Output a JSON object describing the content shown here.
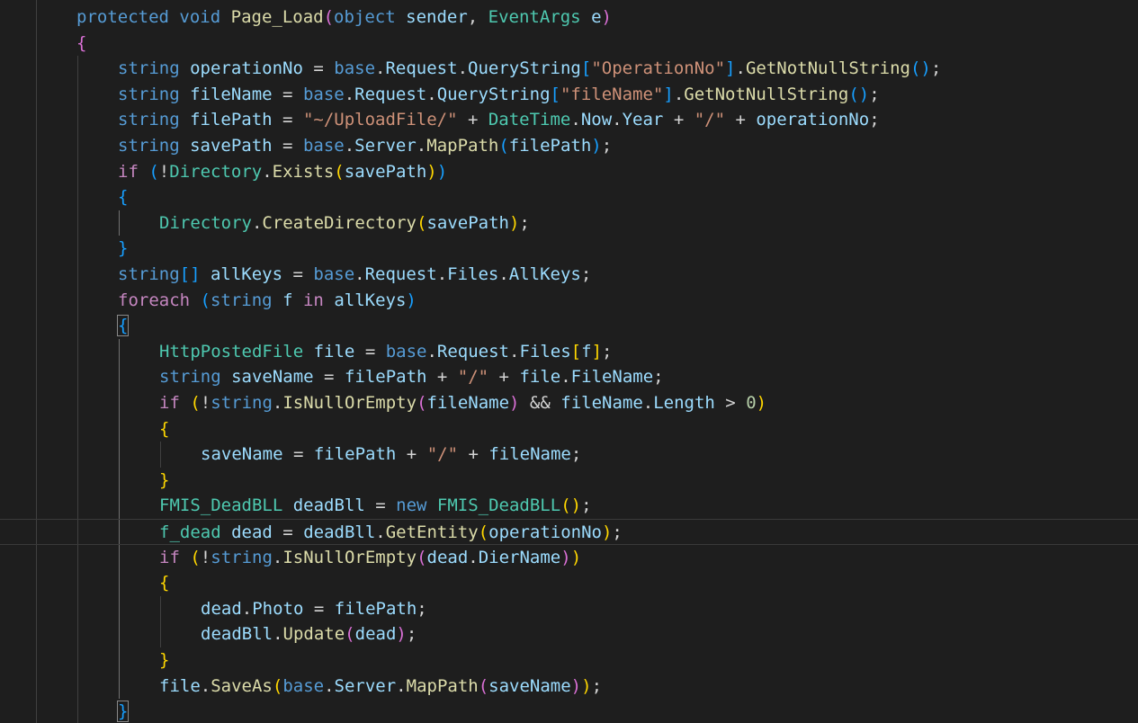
{
  "editor": {
    "language": "csharp",
    "theme": "dark",
    "colors": {
      "background": "#1e1e1e",
      "keyword": "#569cd6",
      "control": "#c586c0",
      "type": "#4ec9b0",
      "function": "#dcdcaa",
      "variable": "#9cdcfe",
      "string": "#ce9178",
      "number": "#b5cea8",
      "bracket_level_1": "#ffd700",
      "bracket_level_2": "#da70d6",
      "bracket_level_3": "#179fff"
    },
    "current_line": 20,
    "matched_bracket_lines": [
      12,
      27
    ],
    "lines": [
      {
        "indent": 1,
        "tokens": [
          {
            "t": "kw",
            "v": "protected"
          },
          {
            "t": "p",
            "v": " "
          },
          {
            "t": "kw",
            "v": "void"
          },
          {
            "t": "p",
            "v": " "
          },
          {
            "t": "fn",
            "v": "Page_Load"
          },
          {
            "t": "b2",
            "v": "("
          },
          {
            "t": "kw",
            "v": "object"
          },
          {
            "t": "p",
            "v": " "
          },
          {
            "t": "var",
            "v": "sender"
          },
          {
            "t": "p",
            "v": ", "
          },
          {
            "t": "type",
            "v": "EventArgs"
          },
          {
            "t": "p",
            "v": " "
          },
          {
            "t": "var",
            "v": "e"
          },
          {
            "t": "b2",
            "v": ")"
          }
        ]
      },
      {
        "indent": 1,
        "tokens": [
          {
            "t": "b2",
            "v": "{"
          }
        ]
      },
      {
        "indent": 2,
        "tokens": [
          {
            "t": "kw",
            "v": "string"
          },
          {
            "t": "p",
            "v": " "
          },
          {
            "t": "var",
            "v": "operationNo"
          },
          {
            "t": "p",
            "v": " = "
          },
          {
            "t": "kw",
            "v": "base"
          },
          {
            "t": "p",
            "v": "."
          },
          {
            "t": "var",
            "v": "Request"
          },
          {
            "t": "p",
            "v": "."
          },
          {
            "t": "var",
            "v": "QueryString"
          },
          {
            "t": "b3",
            "v": "["
          },
          {
            "t": "str",
            "v": "\"OperationNo\""
          },
          {
            "t": "b3",
            "v": "]"
          },
          {
            "t": "p",
            "v": "."
          },
          {
            "t": "fn",
            "v": "GetNotNullString"
          },
          {
            "t": "b3",
            "v": "()"
          },
          {
            "t": "p",
            "v": ";"
          }
        ]
      },
      {
        "indent": 2,
        "tokens": [
          {
            "t": "kw",
            "v": "string"
          },
          {
            "t": "p",
            "v": " "
          },
          {
            "t": "var",
            "v": "fileName"
          },
          {
            "t": "p",
            "v": " = "
          },
          {
            "t": "kw",
            "v": "base"
          },
          {
            "t": "p",
            "v": "."
          },
          {
            "t": "var",
            "v": "Request"
          },
          {
            "t": "p",
            "v": "."
          },
          {
            "t": "var",
            "v": "QueryString"
          },
          {
            "t": "b3",
            "v": "["
          },
          {
            "t": "str",
            "v": "\"fileName\""
          },
          {
            "t": "b3",
            "v": "]"
          },
          {
            "t": "p",
            "v": "."
          },
          {
            "t": "fn",
            "v": "GetNotNullString"
          },
          {
            "t": "b3",
            "v": "()"
          },
          {
            "t": "p",
            "v": ";"
          }
        ]
      },
      {
        "indent": 2,
        "tokens": [
          {
            "t": "kw",
            "v": "string"
          },
          {
            "t": "p",
            "v": " "
          },
          {
            "t": "var",
            "v": "filePath"
          },
          {
            "t": "p",
            "v": " = "
          },
          {
            "t": "str",
            "v": "\"~/UploadFile/\""
          },
          {
            "t": "p",
            "v": " + "
          },
          {
            "t": "type",
            "v": "DateTime"
          },
          {
            "t": "p",
            "v": "."
          },
          {
            "t": "var",
            "v": "Now"
          },
          {
            "t": "p",
            "v": "."
          },
          {
            "t": "var",
            "v": "Year"
          },
          {
            "t": "p",
            "v": " + "
          },
          {
            "t": "str",
            "v": "\"/\""
          },
          {
            "t": "p",
            "v": " + "
          },
          {
            "t": "var",
            "v": "operationNo"
          },
          {
            "t": "p",
            "v": ";"
          }
        ]
      },
      {
        "indent": 2,
        "tokens": [
          {
            "t": "kw",
            "v": "string"
          },
          {
            "t": "p",
            "v": " "
          },
          {
            "t": "var",
            "v": "savePath"
          },
          {
            "t": "p",
            "v": " = "
          },
          {
            "t": "kw",
            "v": "base"
          },
          {
            "t": "p",
            "v": "."
          },
          {
            "t": "var",
            "v": "Server"
          },
          {
            "t": "p",
            "v": "."
          },
          {
            "t": "fn",
            "v": "MapPath"
          },
          {
            "t": "b3",
            "v": "("
          },
          {
            "t": "var",
            "v": "filePath"
          },
          {
            "t": "b3",
            "v": ")"
          },
          {
            "t": "p",
            "v": ";"
          }
        ]
      },
      {
        "indent": 2,
        "tokens": [
          {
            "t": "ctl",
            "v": "if"
          },
          {
            "t": "p",
            "v": " "
          },
          {
            "t": "b3",
            "v": "("
          },
          {
            "t": "p",
            "v": "!"
          },
          {
            "t": "type",
            "v": "Directory"
          },
          {
            "t": "p",
            "v": "."
          },
          {
            "t": "fn",
            "v": "Exists"
          },
          {
            "t": "b1",
            "v": "("
          },
          {
            "t": "var",
            "v": "savePath"
          },
          {
            "t": "b1",
            "v": ")"
          },
          {
            "t": "b3",
            "v": ")"
          }
        ]
      },
      {
        "indent": 2,
        "tokens": [
          {
            "t": "b3",
            "v": "{"
          }
        ]
      },
      {
        "indent": 3,
        "tokens": [
          {
            "t": "type",
            "v": "Directory"
          },
          {
            "t": "p",
            "v": "."
          },
          {
            "t": "fn",
            "v": "CreateDirectory"
          },
          {
            "t": "b1",
            "v": "("
          },
          {
            "t": "var",
            "v": "savePath"
          },
          {
            "t": "b1",
            "v": ")"
          },
          {
            "t": "p",
            "v": ";"
          }
        ]
      },
      {
        "indent": 2,
        "tokens": [
          {
            "t": "b3",
            "v": "}"
          }
        ]
      },
      {
        "indent": 2,
        "tokens": [
          {
            "t": "kw",
            "v": "string"
          },
          {
            "t": "b3",
            "v": "[]"
          },
          {
            "t": "p",
            "v": " "
          },
          {
            "t": "var",
            "v": "allKeys"
          },
          {
            "t": "p",
            "v": " = "
          },
          {
            "t": "kw",
            "v": "base"
          },
          {
            "t": "p",
            "v": "."
          },
          {
            "t": "var",
            "v": "Request"
          },
          {
            "t": "p",
            "v": "."
          },
          {
            "t": "var",
            "v": "Files"
          },
          {
            "t": "p",
            "v": "."
          },
          {
            "t": "var",
            "v": "AllKeys"
          },
          {
            "t": "p",
            "v": ";"
          }
        ]
      },
      {
        "indent": 2,
        "tokens": [
          {
            "t": "ctl",
            "v": "foreach"
          },
          {
            "t": "p",
            "v": " "
          },
          {
            "t": "b3",
            "v": "("
          },
          {
            "t": "kw",
            "v": "string"
          },
          {
            "t": "p",
            "v": " "
          },
          {
            "t": "var",
            "v": "f"
          },
          {
            "t": "p",
            "v": " "
          },
          {
            "t": "ctl",
            "v": "in"
          },
          {
            "t": "p",
            "v": " "
          },
          {
            "t": "var",
            "v": "allKeys"
          },
          {
            "t": "b3",
            "v": ")"
          }
        ]
      },
      {
        "indent": 2,
        "tokens": [
          {
            "t": "b3",
            "v": "{"
          }
        ]
      },
      {
        "indent": 3,
        "tokens": [
          {
            "t": "type",
            "v": "HttpPostedFile"
          },
          {
            "t": "p",
            "v": " "
          },
          {
            "t": "var",
            "v": "file"
          },
          {
            "t": "p",
            "v": " = "
          },
          {
            "t": "kw",
            "v": "base"
          },
          {
            "t": "p",
            "v": "."
          },
          {
            "t": "var",
            "v": "Request"
          },
          {
            "t": "p",
            "v": "."
          },
          {
            "t": "var",
            "v": "Files"
          },
          {
            "t": "b1",
            "v": "["
          },
          {
            "t": "var",
            "v": "f"
          },
          {
            "t": "b1",
            "v": "]"
          },
          {
            "t": "p",
            "v": ";"
          }
        ]
      },
      {
        "indent": 3,
        "tokens": [
          {
            "t": "kw",
            "v": "string"
          },
          {
            "t": "p",
            "v": " "
          },
          {
            "t": "var",
            "v": "saveName"
          },
          {
            "t": "p",
            "v": " = "
          },
          {
            "t": "var",
            "v": "filePath"
          },
          {
            "t": "p",
            "v": " + "
          },
          {
            "t": "str",
            "v": "\"/\""
          },
          {
            "t": "p",
            "v": " + "
          },
          {
            "t": "var",
            "v": "file"
          },
          {
            "t": "p",
            "v": "."
          },
          {
            "t": "var",
            "v": "FileName"
          },
          {
            "t": "p",
            "v": ";"
          }
        ]
      },
      {
        "indent": 3,
        "tokens": [
          {
            "t": "ctl",
            "v": "if"
          },
          {
            "t": "p",
            "v": " "
          },
          {
            "t": "b1",
            "v": "("
          },
          {
            "t": "p",
            "v": "!"
          },
          {
            "t": "kw",
            "v": "string"
          },
          {
            "t": "p",
            "v": "."
          },
          {
            "t": "fn",
            "v": "IsNullOrEmpty"
          },
          {
            "t": "b2",
            "v": "("
          },
          {
            "t": "var",
            "v": "fileName"
          },
          {
            "t": "b2",
            "v": ")"
          },
          {
            "t": "p",
            "v": " && "
          },
          {
            "t": "var",
            "v": "fileName"
          },
          {
            "t": "p",
            "v": "."
          },
          {
            "t": "var",
            "v": "Length"
          },
          {
            "t": "p",
            "v": " > "
          },
          {
            "t": "num",
            "v": "0"
          },
          {
            "t": "b1",
            "v": ")"
          }
        ]
      },
      {
        "indent": 3,
        "tokens": [
          {
            "t": "b1",
            "v": "{"
          }
        ]
      },
      {
        "indent": 4,
        "tokens": [
          {
            "t": "var",
            "v": "saveName"
          },
          {
            "t": "p",
            "v": " = "
          },
          {
            "t": "var",
            "v": "filePath"
          },
          {
            "t": "p",
            "v": " + "
          },
          {
            "t": "str",
            "v": "\"/\""
          },
          {
            "t": "p",
            "v": " + "
          },
          {
            "t": "var",
            "v": "fileName"
          },
          {
            "t": "p",
            "v": ";"
          }
        ]
      },
      {
        "indent": 3,
        "tokens": [
          {
            "t": "b1",
            "v": "}"
          }
        ]
      },
      {
        "indent": 3,
        "tokens": [
          {
            "t": "type",
            "v": "FMIS_DeadBLL"
          },
          {
            "t": "p",
            "v": " "
          },
          {
            "t": "var",
            "v": "deadBll"
          },
          {
            "t": "p",
            "v": " = "
          },
          {
            "t": "kw",
            "v": "new"
          },
          {
            "t": "p",
            "v": " "
          },
          {
            "t": "type",
            "v": "FMIS_DeadBLL"
          },
          {
            "t": "b1",
            "v": "()"
          },
          {
            "t": "p",
            "v": ";"
          }
        ]
      },
      {
        "indent": 3,
        "tokens": [
          {
            "t": "type",
            "v": "f_dead"
          },
          {
            "t": "p",
            "v": " "
          },
          {
            "t": "var",
            "v": "dead"
          },
          {
            "t": "p",
            "v": " = "
          },
          {
            "t": "var",
            "v": "deadBll"
          },
          {
            "t": "p",
            "v": "."
          },
          {
            "t": "fn",
            "v": "GetEntity"
          },
          {
            "t": "b1",
            "v": "("
          },
          {
            "t": "var",
            "v": "operationNo"
          },
          {
            "t": "b1",
            "v": ")"
          },
          {
            "t": "p",
            "v": ";"
          }
        ]
      },
      {
        "indent": 3,
        "tokens": [
          {
            "t": "ctl",
            "v": "if"
          },
          {
            "t": "p",
            "v": " "
          },
          {
            "t": "b1",
            "v": "("
          },
          {
            "t": "p",
            "v": "!"
          },
          {
            "t": "kw",
            "v": "string"
          },
          {
            "t": "p",
            "v": "."
          },
          {
            "t": "fn",
            "v": "IsNullOrEmpty"
          },
          {
            "t": "b2",
            "v": "("
          },
          {
            "t": "var",
            "v": "dead"
          },
          {
            "t": "p",
            "v": "."
          },
          {
            "t": "var",
            "v": "DierName"
          },
          {
            "t": "b2",
            "v": ")"
          },
          {
            "t": "b1",
            "v": ")"
          }
        ]
      },
      {
        "indent": 3,
        "tokens": [
          {
            "t": "b1",
            "v": "{"
          }
        ]
      },
      {
        "indent": 4,
        "tokens": [
          {
            "t": "var",
            "v": "dead"
          },
          {
            "t": "p",
            "v": "."
          },
          {
            "t": "var",
            "v": "Photo"
          },
          {
            "t": "p",
            "v": " = "
          },
          {
            "t": "var",
            "v": "filePath"
          },
          {
            "t": "p",
            "v": ";"
          }
        ]
      },
      {
        "indent": 4,
        "tokens": [
          {
            "t": "var",
            "v": "deadBll"
          },
          {
            "t": "p",
            "v": "."
          },
          {
            "t": "fn",
            "v": "Update"
          },
          {
            "t": "b2",
            "v": "("
          },
          {
            "t": "var",
            "v": "dead"
          },
          {
            "t": "b2",
            "v": ")"
          },
          {
            "t": "p",
            "v": ";"
          }
        ]
      },
      {
        "indent": 3,
        "tokens": [
          {
            "t": "b1",
            "v": "}"
          }
        ]
      },
      {
        "indent": 3,
        "tokens": [
          {
            "t": "var",
            "v": "file"
          },
          {
            "t": "p",
            "v": "."
          },
          {
            "t": "fn",
            "v": "SaveAs"
          },
          {
            "t": "b1",
            "v": "("
          },
          {
            "t": "kw",
            "v": "base"
          },
          {
            "t": "p",
            "v": "."
          },
          {
            "t": "var",
            "v": "Server"
          },
          {
            "t": "p",
            "v": "."
          },
          {
            "t": "fn",
            "v": "MapPath"
          },
          {
            "t": "b2",
            "v": "("
          },
          {
            "t": "var",
            "v": "saveName"
          },
          {
            "t": "b2",
            "v": ")"
          },
          {
            "t": "b1",
            "v": ")"
          },
          {
            "t": "p",
            "v": ";"
          }
        ]
      },
      {
        "indent": 2,
        "tokens": [
          {
            "t": "b3",
            "v": "}"
          }
        ]
      }
    ]
  }
}
